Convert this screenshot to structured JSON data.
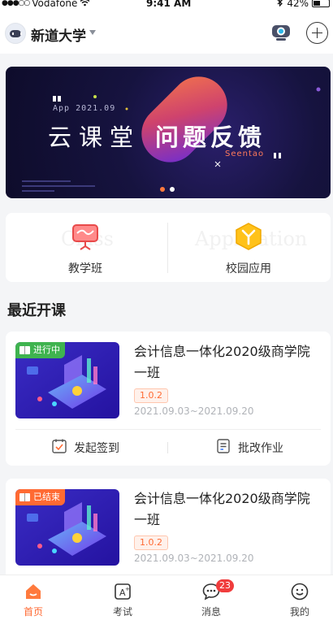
{
  "status_bar": {
    "carrier": "Vodafone",
    "time": "9:41 AM",
    "battery": "42%",
    "battery_level": 0.42
  },
  "header": {
    "school_name": "新道大学"
  },
  "banner": {
    "subtitle": "App 2021.09",
    "title_light": "云课堂",
    "title_bold": "问题反馈",
    "signature": "Seentao",
    "slide_count": 2,
    "active_slide": 1
  },
  "entries": [
    {
      "label": "教学班",
      "watermark": "Class",
      "icon": "presentation-board-icon"
    },
    {
      "label": "校园应用",
      "watermark": "Application",
      "icon": "app-hexagon-icon"
    }
  ],
  "section_title": "最近开课",
  "courses": [
    {
      "status": "进行中",
      "status_color": "#3fb34f",
      "name": "会计信息一体化2020级商学院一班",
      "version": "1.0.2",
      "dates": "2021.09.03~2021.09.20",
      "actions": [
        "发起签到",
        "批改作业"
      ]
    },
    {
      "status": "已结束",
      "status_color": "#ff6a33",
      "name": "会计信息一体化2020级商学院一班",
      "version": "1.0.2",
      "dates": "2021.09.03~2021.09.20"
    }
  ],
  "tab_bar": {
    "tabs": [
      {
        "label": "首页",
        "icon": "home-icon",
        "active": true
      },
      {
        "label": "考试",
        "icon": "exam-icon"
      },
      {
        "label": "消息",
        "icon": "message-icon",
        "badge": "23"
      },
      {
        "label": "我的",
        "icon": "profile-icon"
      }
    ]
  },
  "colors": {
    "accent": "#ff6a33",
    "running": "#3fb34f",
    "badge": "#f03c3c",
    "page_bg": "#f4f5f7"
  }
}
